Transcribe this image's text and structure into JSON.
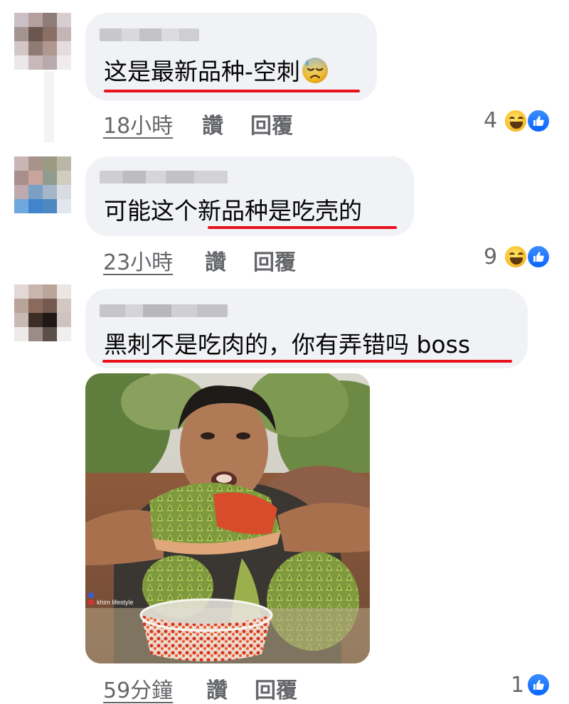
{
  "comments": [
    {
      "text": "这是最新品种-空刺",
      "time": "18小時",
      "like_label": "讚",
      "reply_label": "回覆",
      "reaction_count": "4",
      "reactions": [
        "laughing-emoji-icon",
        "like-thumb-icon"
      ]
    },
    {
      "text": "可能这个新品种是吃壳的",
      "time": "23小時",
      "like_label": "讚",
      "reply_label": "回覆",
      "reaction_count": "9",
      "reactions": [
        "laughing-emoji-icon",
        "like-thumb-icon"
      ]
    },
    {
      "text": "黑刺不是吃肉的，你有弄错吗 boss",
      "time": "59分鐘",
      "like_label": "讚",
      "reply_label": "回覆",
      "reaction_count": "1",
      "reactions": [
        "like-thumb-icon"
      ],
      "attachment_watermark": "khim lifestyle"
    }
  ],
  "colors": {
    "bubble": "#f0f2f5",
    "underline": "#e8121d",
    "meta_text": "#65676b",
    "like_blue": "#0866ff"
  }
}
